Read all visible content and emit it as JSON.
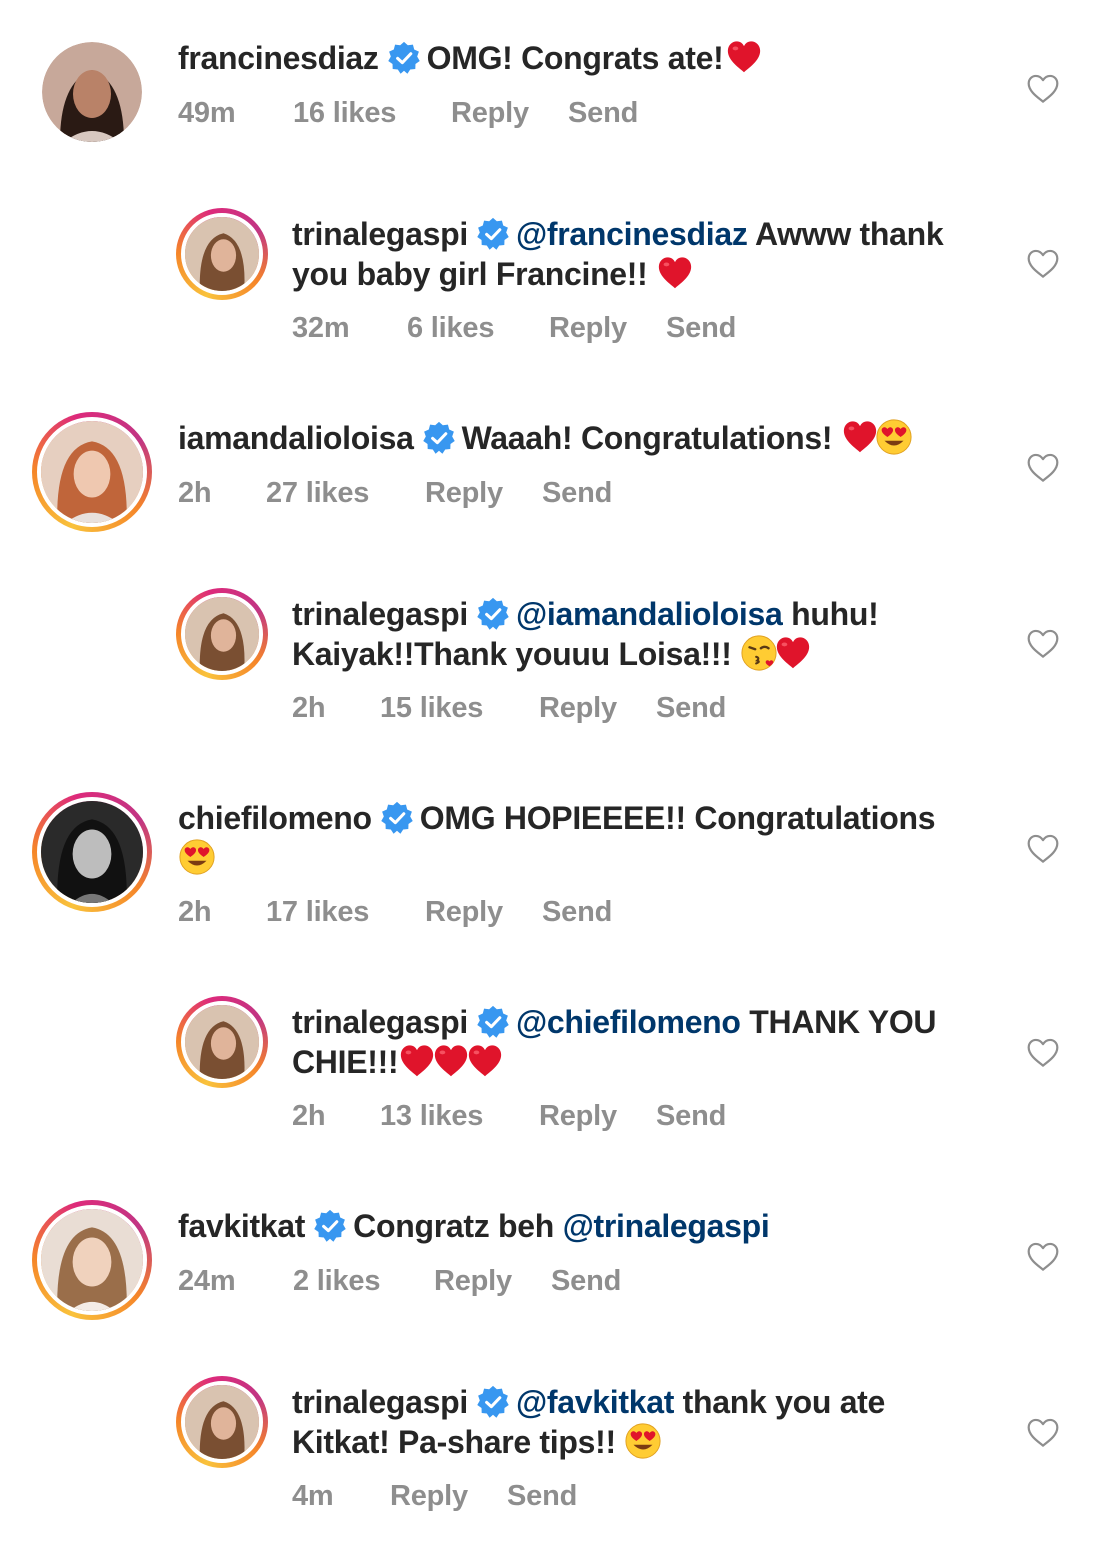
{
  "comments": [
    {
      "username": "francinesdiaz",
      "line1": "OMG! Congrats ate!",
      "line2": "",
      "mention": "",
      "time": "49m",
      "likes": "16 likes",
      "reply": "Reply",
      "send": "Send",
      "emojis_line1": [
        "heart"
      ],
      "emojis_line2": []
    },
    {
      "username": "trinalegaspi",
      "mention": "@francinesdiaz",
      "line1": "Awww thank",
      "line2": "you baby girl Francine!!",
      "time": "32m",
      "likes": "6 likes",
      "reply": "Reply",
      "send": "Send",
      "emojis_line2": [
        "heart"
      ]
    },
    {
      "username": "iamandalioloisa",
      "line1": "Waaah! Congratulations!",
      "mention": "",
      "time": "2h",
      "likes": "27 likes",
      "reply": "Reply",
      "send": "Send",
      "emojis_line1": [
        "heart",
        "heart-eyes"
      ]
    },
    {
      "username": "trinalegaspi",
      "mention": "@iamandalioloisa",
      "line1": "huhu!",
      "line2": "Kaiyak!!Thank youuu Loisa!!!",
      "time": "2h",
      "likes": "15 likes",
      "reply": "Reply",
      "send": "Send",
      "emojis_line2": [
        "kiss",
        "heart"
      ]
    },
    {
      "username": "chiefilomeno",
      "line1": "OMG HOPIEEEE!! Congratulations",
      "mention": "",
      "time": "2h",
      "likes": "17 likes",
      "reply": "Reply",
      "send": "Send",
      "emojis_line2": [
        "heart-eyes"
      ]
    },
    {
      "username": "trinalegaspi",
      "mention": "@chiefilomeno",
      "line1": "THANK YOU",
      "line2": "CHIE!!!",
      "time": "2h",
      "likes": "13 likes",
      "reply": "Reply",
      "send": "Send",
      "emojis_line2": [
        "heart",
        "heart",
        "heart"
      ]
    },
    {
      "username": "favkitkat",
      "line1": "Congratz beh",
      "mention": "@trinalegaspi",
      "time": "24m",
      "likes": "2 likes",
      "reply": "Reply",
      "send": "Send"
    },
    {
      "username": "trinalegaspi",
      "mention": "@favkitkat",
      "line1": "thank you ate",
      "line2": "Kitkat! Pa-share tips!!",
      "time": "4m",
      "likes": "",
      "reply": "Reply",
      "send": "Send",
      "emojis_line2": [
        "heart-eyes"
      ]
    }
  ],
  "icons": {
    "verified": "verified-badge-icon",
    "like": "heart-outline-icon"
  },
  "colors": {
    "verified": "#3897f0",
    "mention": "#00376b",
    "meta": "#8e8e8e",
    "heart_emoji": "#e0142b"
  }
}
